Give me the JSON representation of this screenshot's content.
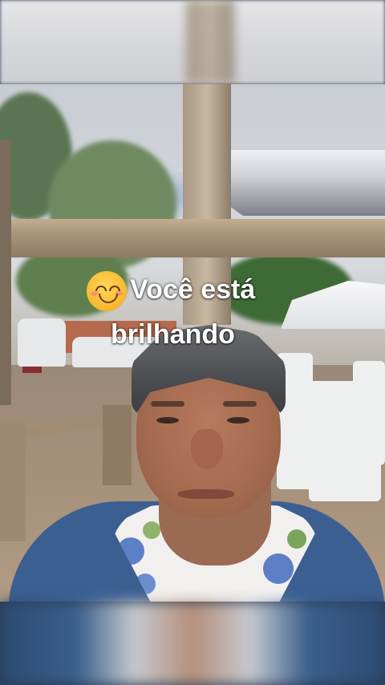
{
  "caption": {
    "line1": "Você está",
    "line2": "brilhando",
    "emoji": "smiling-face-with-smiling-eyes"
  },
  "colors": {
    "caption_text": "#ffffff",
    "shirt": "#3b5f91",
    "wood": "#b09a80"
  }
}
